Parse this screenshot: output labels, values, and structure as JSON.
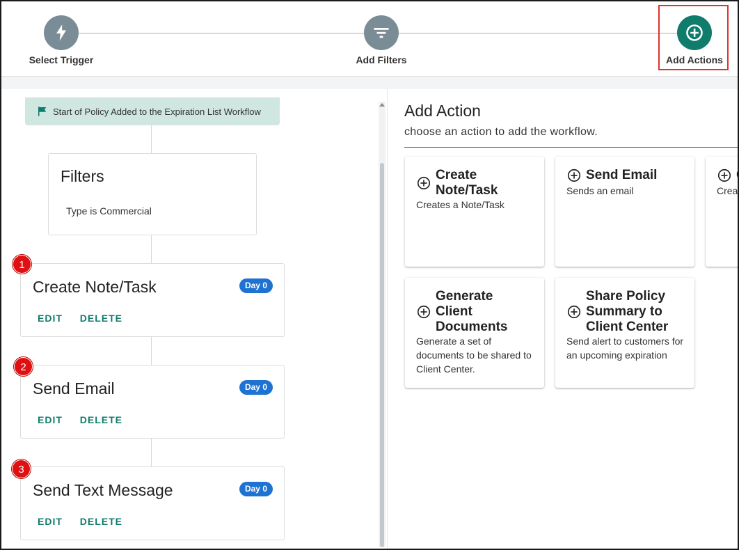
{
  "stepper": {
    "steps": [
      {
        "label": "Select Trigger",
        "icon": "lightning-icon",
        "state": "inactive"
      },
      {
        "label": "Add Filters",
        "icon": "filter-icon",
        "state": "inactive"
      },
      {
        "label": "Add Actions",
        "icon": "plus-circle-icon",
        "state": "active"
      }
    ],
    "active_color": "#0f7c6c",
    "inactive_color": "#7a8c96",
    "highlight_color": "#e0312c"
  },
  "workflow": {
    "start_banner": "Start of Policy Added to the Expiration List Workflow",
    "filters": {
      "title": "Filters",
      "text": "Type is Commercial"
    },
    "actions": [
      {
        "number": "1",
        "title": "Create Note/Task",
        "badge": "Day 0",
        "edit": "EDIT",
        "delete": "DELETE"
      },
      {
        "number": "2",
        "title": "Send Email",
        "badge": "Day 0",
        "edit": "EDIT",
        "delete": "DELETE"
      },
      {
        "number": "3",
        "title": "Send Text Message",
        "badge": "Day 0",
        "edit": "EDIT",
        "delete": "DELETE"
      }
    ]
  },
  "add_action": {
    "title": "Add Action",
    "subtitle": "choose an action to add the workflow.",
    "options": [
      {
        "title": "Create Note/Task",
        "description": "Creates a Note/Task"
      },
      {
        "title": "Send Email",
        "description": "Sends an email"
      },
      {
        "title": "C",
        "description": "Crea"
      },
      {
        "title": "Generate Client Documents",
        "description": "Generate a set of documents to be shared to Client Center."
      },
      {
        "title": "Share Policy Summary to Client Center",
        "description": "Send alert to customers for an upcoming expiration"
      }
    ]
  }
}
